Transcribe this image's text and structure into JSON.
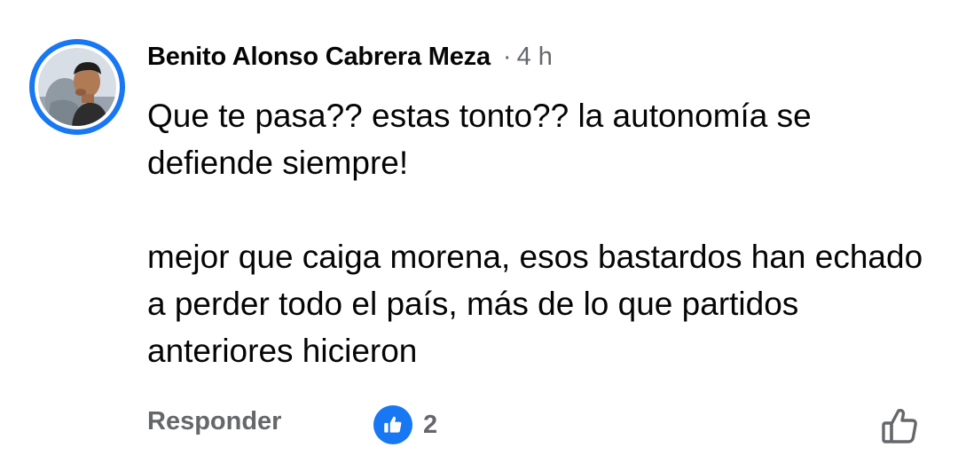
{
  "comment": {
    "author": "Benito Alonso Cabrera Meza",
    "separator": "·",
    "time": "4 h",
    "paragraphs": [
      "Que te pasa?? estas tonto?? la autonomía se defiende siempre!",
      "mejor que caiga morena, esos bastardos han echado a perder todo el país, más de lo que partidos anteriores hicieron"
    ]
  },
  "actions": {
    "reply_label": "Responder",
    "reaction_count": "2",
    "reaction_icon": "like-thumb-icon",
    "like_icon": "thumbs-up-outline-icon"
  },
  "colors": {
    "accent": "#1877f2",
    "text": "#050505",
    "secondary": "#65676b"
  }
}
